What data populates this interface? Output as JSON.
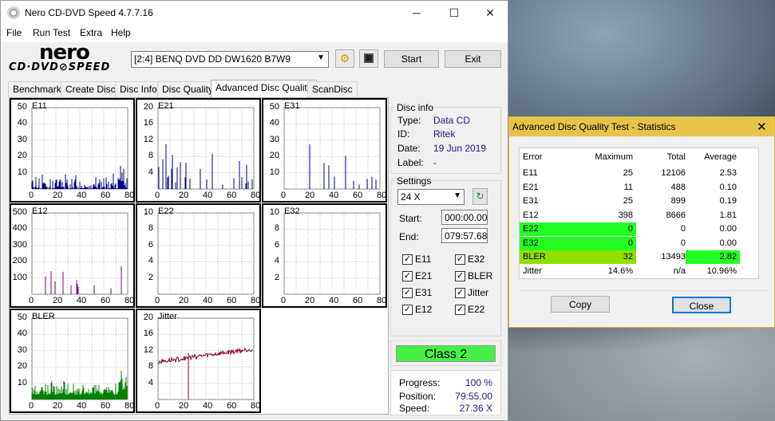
{
  "app": {
    "title": "Nero CD-DVD Speed 4.7.7.16",
    "logo_top": "nero",
    "logo_bottom": "CD·DVD⊘SPEED"
  },
  "menu": [
    "File",
    "Run Test",
    "Extra",
    "Help"
  ],
  "toolbar": {
    "drive": "[2:4]   BENQ DVD DD DW1620 B7W9",
    "start": "Start",
    "exit": "Exit"
  },
  "tabs": [
    "Benchmark",
    "Create Disc",
    "Disc Info",
    "Disc Quality",
    "Advanced Disc Quality",
    "ScanDisc"
  ],
  "disc_info": {
    "title": "Disc info",
    "type_label": "Type:",
    "type": "Data CD",
    "id_label": "ID:",
    "id": "Ritek",
    "date_label": "Date:",
    "date": "19 Jun 2019",
    "label_label": "Label:",
    "label": "-"
  },
  "settings": {
    "title": "Settings",
    "speed": "24 X",
    "start_label": "Start:",
    "start": "000:00.00",
    "end_label": "End:",
    "end": "079:57.68",
    "checks": [
      {
        "label": "E11",
        "checked": true
      },
      {
        "label": "E32",
        "checked": true
      },
      {
        "label": "E21",
        "checked": true
      },
      {
        "label": "BLER",
        "checked": true
      },
      {
        "label": "E31",
        "checked": true
      },
      {
        "label": "Jitter",
        "checked": true
      },
      {
        "label": "E12",
        "checked": true
      },
      {
        "label": "E22",
        "checked": true
      }
    ]
  },
  "class_label": "Class 2",
  "progress": {
    "progress_label": "Progress:",
    "progress": "100 %",
    "position_label": "Position:",
    "position": "79:55.00",
    "speed_label": "Speed:",
    "speed": "27.36 X"
  },
  "charts": [
    {
      "name": "E11",
      "yticks": [
        "50",
        "40",
        "30",
        "20",
        "10"
      ],
      "xticks": [
        "0",
        "20",
        "40",
        "60",
        "80"
      ]
    },
    {
      "name": "E21",
      "yticks": [
        "20",
        "16",
        "12",
        "8",
        "4"
      ],
      "xticks": [
        "0",
        "20",
        "40",
        "60",
        "80"
      ]
    },
    {
      "name": "E31",
      "yticks": [
        "50",
        "40",
        "30",
        "20",
        "10"
      ],
      "xticks": [
        "0",
        "20",
        "40",
        "60",
        "80"
      ]
    },
    {
      "name": "E12",
      "yticks": [
        "500",
        "400",
        "300",
        "200",
        "100"
      ],
      "xticks": [
        "0",
        "20",
        "40",
        "60",
        "80"
      ]
    },
    {
      "name": "E22",
      "yticks": [
        "10",
        "8",
        "6",
        "4",
        "2"
      ],
      "xticks": [
        "0",
        "20",
        "40",
        "60",
        "80"
      ]
    },
    {
      "name": "E32",
      "yticks": [
        "10",
        "8",
        "6",
        "4",
        "2"
      ],
      "xticks": [
        "0",
        "20",
        "40",
        "60",
        "80"
      ]
    },
    {
      "name": "BLER",
      "yticks": [
        "50",
        "40",
        "30",
        "20",
        "10"
      ],
      "xticks": [
        "0",
        "20",
        "40",
        "60",
        "80"
      ]
    },
    {
      "name": "Jitter",
      "yticks": [
        "20",
        "16",
        "12",
        "8",
        "4"
      ],
      "xticks": [
        "0",
        "20",
        "40",
        "60",
        "80"
      ]
    }
  ],
  "stats": {
    "title": "Advanced Disc Quality Test - Statistics",
    "headers": [
      "Error",
      "Maximum",
      "Total",
      "Average"
    ],
    "rows": [
      [
        "E11",
        "25",
        "12106",
        "2.53"
      ],
      [
        "E21",
        "11",
        "488",
        "0.10"
      ],
      [
        "E31",
        "25",
        "899",
        "0.19"
      ],
      [
        "E12",
        "398",
        "8666",
        "1.81"
      ],
      [
        "E22",
        "0",
        "0",
        "0.00"
      ],
      [
        "E32",
        "0",
        "0",
        "0.00"
      ],
      [
        "BLER",
        "32",
        "13493",
        "2.82"
      ],
      [
        "Jitter",
        "14.6%",
        "n/a",
        "10.96%"
      ]
    ],
    "copy": "Copy",
    "close": "Close"
  }
}
